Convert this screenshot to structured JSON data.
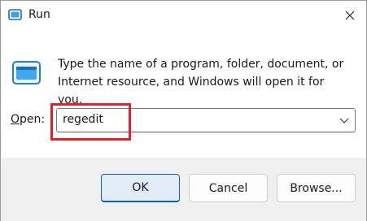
{
  "window": {
    "title": "Run",
    "close_icon": "close-icon"
  },
  "body": {
    "description": "Type the name of a program, folder, document, or Internet resource, and Windows will open it for you."
  },
  "open": {
    "label_underlined": "O",
    "label_rest": "pen:",
    "value": "regedit",
    "dropdown_icon": "chevron-down-icon"
  },
  "buttons": {
    "ok": "OK",
    "cancel": "Cancel",
    "browse": "Browse..."
  },
  "colors": {
    "accent": "#0067c0",
    "highlight_box": "#e0202a",
    "footer_bg": "#f0f0f0"
  }
}
